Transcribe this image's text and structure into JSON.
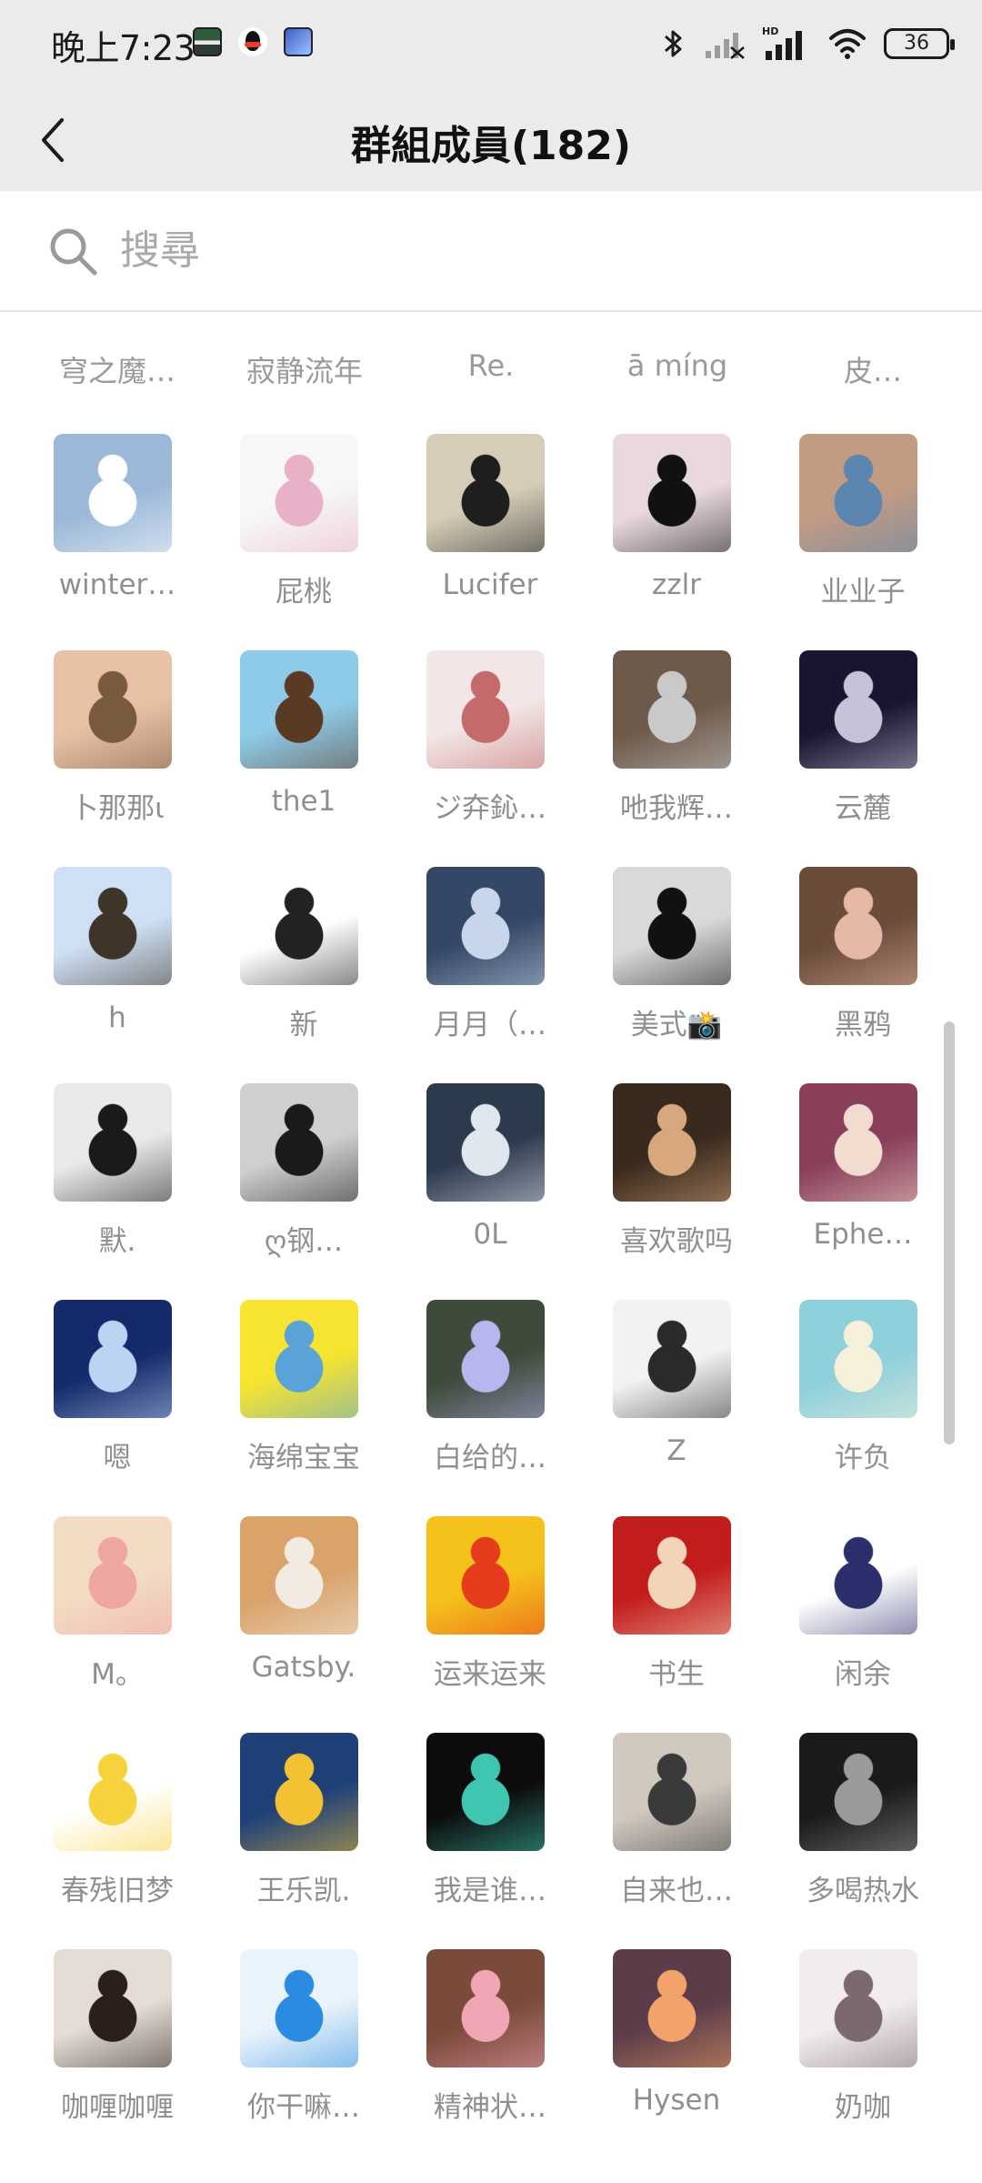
{
  "status_bar": {
    "time": "晚上7:23",
    "battery": "36",
    "icons": [
      "bluetooth-icon",
      "signal-icon",
      "hd-signal-icon",
      "wifi-icon",
      "battery-icon"
    ]
  },
  "header": {
    "title": "群組成員(182)",
    "back_icon": "chevron-left-icon"
  },
  "search": {
    "placeholder": "搜尋",
    "value": ""
  },
  "partial_row": [
    "穹之魔…",
    "寂静流年",
    "Re.",
    "ā míng",
    "皮…"
  ],
  "members": [
    {
      "name": "winter…",
      "avatar": [
        "#9bb8d8",
        "#ffffff"
      ]
    },
    {
      "name": "屁桃",
      "avatar": [
        "#f7f7f7",
        "#e9b1c7"
      ]
    },
    {
      "name": "Lucifer",
      "avatar": [
        "#d6cdb8",
        "#1e1e1e"
      ]
    },
    {
      "name": "zzlr",
      "avatar": [
        "#e9d9df",
        "#111111"
      ]
    },
    {
      "name": "业业子",
      "avatar": [
        "#c29b83",
        "#5b86b0"
      ]
    },
    {
      "name": "卜那那ι",
      "avatar": [
        "#e8c1a5",
        "#7a5a3e"
      ]
    },
    {
      "name": "the1",
      "avatar": [
        "#8ecbe8",
        "#5b3a24"
      ]
    },
    {
      "name": "ジ㚏鈊…",
      "avatar": [
        "#f2e6e6",
        "#c56a6a"
      ]
    },
    {
      "name": "吔我辉…",
      "avatar": [
        "#6e5a4a",
        "#c9c9c9"
      ]
    },
    {
      "name": "云麓",
      "avatar": [
        "#1b1430",
        "#c7c2d8"
      ]
    },
    {
      "name": "h",
      "avatar": [
        "#cfe0f5",
        "#3e3528"
      ]
    },
    {
      "name": "新",
      "avatar": [
        "#ffffff",
        "#222222"
      ]
    },
    {
      "name": "月月（…",
      "avatar": [
        "#344766",
        "#c7d6ea"
      ]
    },
    {
      "name": "美式📸",
      "avatar": [
        "#d9d9d9",
        "#111111"
      ]
    },
    {
      "name": "黑鸦",
      "avatar": [
        "#6b4b3a",
        "#e6b8a6"
      ]
    },
    {
      "name": "默.",
      "avatar": [
        "#e9e9e9",
        "#1a1a1a"
      ]
    },
    {
      "name": "ღ钢…",
      "avatar": [
        "#cfcfcf",
        "#1a1a1a"
      ]
    },
    {
      "name": "0L",
      "avatar": [
        "#2d3a4e",
        "#dfe6ee"
      ]
    },
    {
      "name": "喜欢歌吗",
      "avatar": [
        "#3a2a1e",
        "#d7a77e"
      ]
    },
    {
      "name": "Ephe…",
      "avatar": [
        "#8a3e5a",
        "#f1dccf"
      ]
    },
    {
      "name": "嗯",
      "avatar": [
        "#142a6a",
        "#bcd3f4"
      ]
    },
    {
      "name": "海绵宝宝",
      "avatar": [
        "#f6e430",
        "#5aa3d8"
      ]
    },
    {
      "name": "白给的…",
      "avatar": [
        "#3e4a3a",
        "#b7b6ef"
      ]
    },
    {
      "name": "Z",
      "avatar": [
        "#f2f2f2",
        "#2a2a2a"
      ]
    },
    {
      "name": "许负",
      "avatar": [
        "#8ed0dc",
        "#f4f0d9"
      ]
    },
    {
      "name": "M。",
      "avatar": [
        "#f3dcc4",
        "#efa5a2"
      ]
    },
    {
      "name": "Gatsby.",
      "avatar": [
        "#d9a36a",
        "#f2ebe2"
      ]
    },
    {
      "name": "运来运来",
      "avatar": [
        "#f5c21b",
        "#e53c1e"
      ]
    },
    {
      "name": "书生",
      "avatar": [
        "#c21d1d",
        "#f3d4b9"
      ]
    },
    {
      "name": "闲余",
      "avatar": [
        "#ffffff",
        "#2b2f6b"
      ]
    },
    {
      "name": "春残旧梦",
      "avatar": [
        "#ffffff",
        "#f6d23c"
      ]
    },
    {
      "name": "王乐凯.",
      "avatar": [
        "#1f3f77",
        "#f2c233"
      ]
    },
    {
      "name": "我是谁…",
      "avatar": [
        "#0c0c0c",
        "#3fc6b0"
      ]
    },
    {
      "name": "自来也…",
      "avatar": [
        "#d1c8bf",
        "#3a3a3a"
      ]
    },
    {
      "name": "多喝热水",
      "avatar": [
        "#1a1a1a",
        "#9a9a9a"
      ]
    },
    {
      "name": "咖喱咖喱",
      "avatar": [
        "#e3ddd5",
        "#2a1f1a"
      ]
    },
    {
      "name": "你干嘛…",
      "avatar": [
        "#e9f3fb",
        "#2b8be0"
      ]
    },
    {
      "name": "精神状…",
      "avatar": [
        "#7a4a3a",
        "#f0a6b4"
      ]
    },
    {
      "name": "Hysen",
      "avatar": [
        "#5b3c48",
        "#f1a36a"
      ]
    },
    {
      "name": "奶咖",
      "avatar": [
        "#f1ecef",
        "#7a6a70"
      ]
    }
  ]
}
